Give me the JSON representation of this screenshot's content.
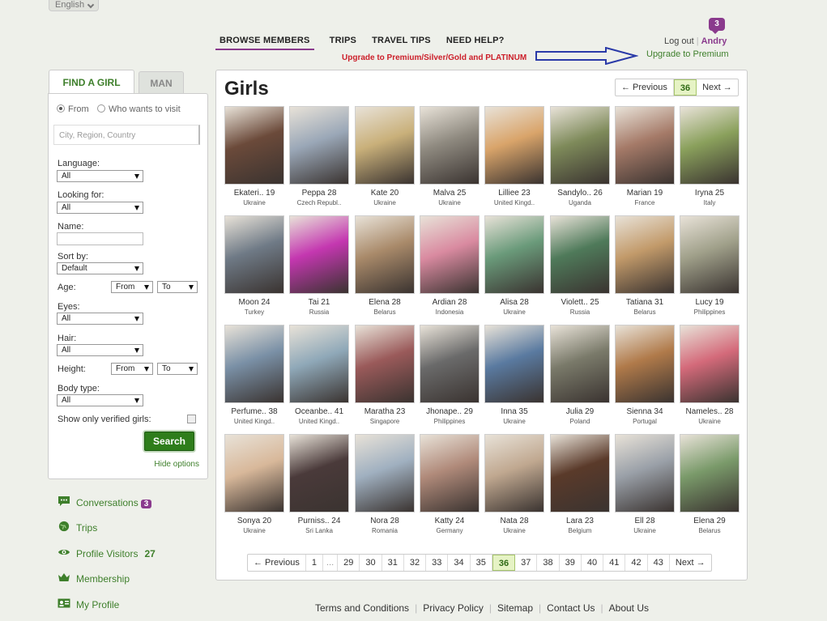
{
  "language": {
    "label": "English"
  },
  "nav": {
    "items": [
      "BROWSE MEMBERS",
      "TRIPS",
      "TRAVEL TIPS",
      "NEED HELP?"
    ],
    "upgrade_notice": "Upgrade to Premium/Silver/Gold and PLATINUM"
  },
  "account": {
    "notifications": "3",
    "logout": "Log out",
    "username": "Andry",
    "upgrade": "Upgrade to Premium"
  },
  "search": {
    "tabs": {
      "girl": "FIND A GIRL",
      "man": "MAN"
    },
    "radio_from": "From",
    "radio_visit": "Who wants to visit",
    "location_placeholder": "City, Region, Country",
    "language_label": "Language:",
    "language_value": "All",
    "looking_label": "Looking for:",
    "looking_value": "All",
    "name_label": "Name:",
    "sort_label": "Sort by:",
    "sort_value": "Default",
    "age_label": "Age:",
    "age_from": "From",
    "age_to": "To",
    "eyes_label": "Eyes:",
    "eyes_value": "All",
    "hair_label": "Hair:",
    "hair_value": "All",
    "height_label": "Height:",
    "height_from": "From",
    "height_to": "To",
    "body_label": "Body type:",
    "body_value": "All",
    "verified_label": "Show only verified girls:",
    "search_button": "Search",
    "hide_options": "Hide options"
  },
  "side_links": {
    "conversations": "Conversations",
    "conversations_count": "3",
    "trips": "Trips",
    "visitors": "Profile Visitors",
    "visitors_count": "27",
    "membership": "Membership",
    "profile": "My Profile"
  },
  "main": {
    "title": "Girls",
    "prev": "← Previous",
    "next": "Next →",
    "current_page": "36",
    "bottom_pages": [
      "1",
      "...",
      "29",
      "30",
      "31",
      "32",
      "33",
      "34",
      "35",
      "36",
      "37",
      "38",
      "39",
      "40",
      "41",
      "42",
      "43"
    ],
    "members": [
      {
        "name": "Ekateri.. 19",
        "country": "Ukraine",
        "color": "#6b4a3a"
      },
      {
        "name": "Peppa 28",
        "country": "Czech Republ..",
        "color": "#9aa7b7"
      },
      {
        "name": "Kate 20",
        "country": "Ukraine",
        "color": "#c9b07a"
      },
      {
        "name": "Malva 25",
        "country": "Ukraine",
        "color": "#8f8a80"
      },
      {
        "name": "Lilliee 23",
        "country": "United Kingd..",
        "color": "#d9a46a"
      },
      {
        "name": "Sandylo.. 26",
        "country": "Uganda",
        "color": "#7e8a5a"
      },
      {
        "name": "Marian 19",
        "country": "France",
        "color": "#a57a68"
      },
      {
        "name": "Iryna 25",
        "country": "Italy",
        "color": "#8aa05c"
      },
      {
        "name": "Moon 24",
        "country": "Turkey",
        "color": "#6f7a86"
      },
      {
        "name": "Tai 21",
        "country": "Russia",
        "color": "#c437b0"
      },
      {
        "name": "Elena 28",
        "country": "Belarus",
        "color": "#a98a6a"
      },
      {
        "name": "Ardian 28",
        "country": "Indonesia",
        "color": "#d98aa0"
      },
      {
        "name": "Alisa 28",
        "country": "Ukraine",
        "color": "#6a9a7a"
      },
      {
        "name": "Violett.. 25",
        "country": "Russia",
        "color": "#4f7a5a"
      },
      {
        "name": "Tatiana 31",
        "country": "Belarus",
        "color": "#c29a6a"
      },
      {
        "name": "Lucy 19",
        "country": "Philippines",
        "color": "#a0a08a"
      },
      {
        "name": "Perfume.. 38",
        "country": "United Kingd..",
        "color": "#7a90a6"
      },
      {
        "name": "Oceanbe.. 41",
        "country": "United Kingd..",
        "color": "#8fa8b8"
      },
      {
        "name": "Maratha 23",
        "country": "Singapore",
        "color": "#9a5a5a"
      },
      {
        "name": "Jhonape.. 29",
        "country": "Philippines",
        "color": "#6a6a6a"
      },
      {
        "name": "Inna 35",
        "country": "Ukraine",
        "color": "#5a7aa0"
      },
      {
        "name": "Julia 29",
        "country": "Poland",
        "color": "#7a7a6a"
      },
      {
        "name": "Sienna 34",
        "country": "Portugal",
        "color": "#b07a4a"
      },
      {
        "name": "Nameles.. 28",
        "country": "Ukraine",
        "color": "#d46a7a"
      },
      {
        "name": "Sonya 20",
        "country": "Ukraine",
        "color": "#d8b89a"
      },
      {
        "name": "Purniss.. 24",
        "country": "Sri Lanka",
        "color": "#4a3a3a"
      },
      {
        "name": "Nora 28",
        "country": "Romania",
        "color": "#a0b0c0"
      },
      {
        "name": "Katty 24",
        "country": "Germany",
        "color": "#b08a7a"
      },
      {
        "name": "Nata 28",
        "country": "Ukraine",
        "color": "#c0a890"
      },
      {
        "name": "Lara 23",
        "country": "Belgium",
        "color": "#5a3a2a"
      },
      {
        "name": "Ell 28",
        "country": "Ukraine",
        "color": "#9aa0a8"
      },
      {
        "name": "Elena 29",
        "country": "Belarus",
        "color": "#7a9a6a"
      }
    ]
  },
  "footer": [
    "Terms and Conditions",
    "Privacy Policy",
    "Sitemap",
    "Contact Us",
    "About Us"
  ]
}
